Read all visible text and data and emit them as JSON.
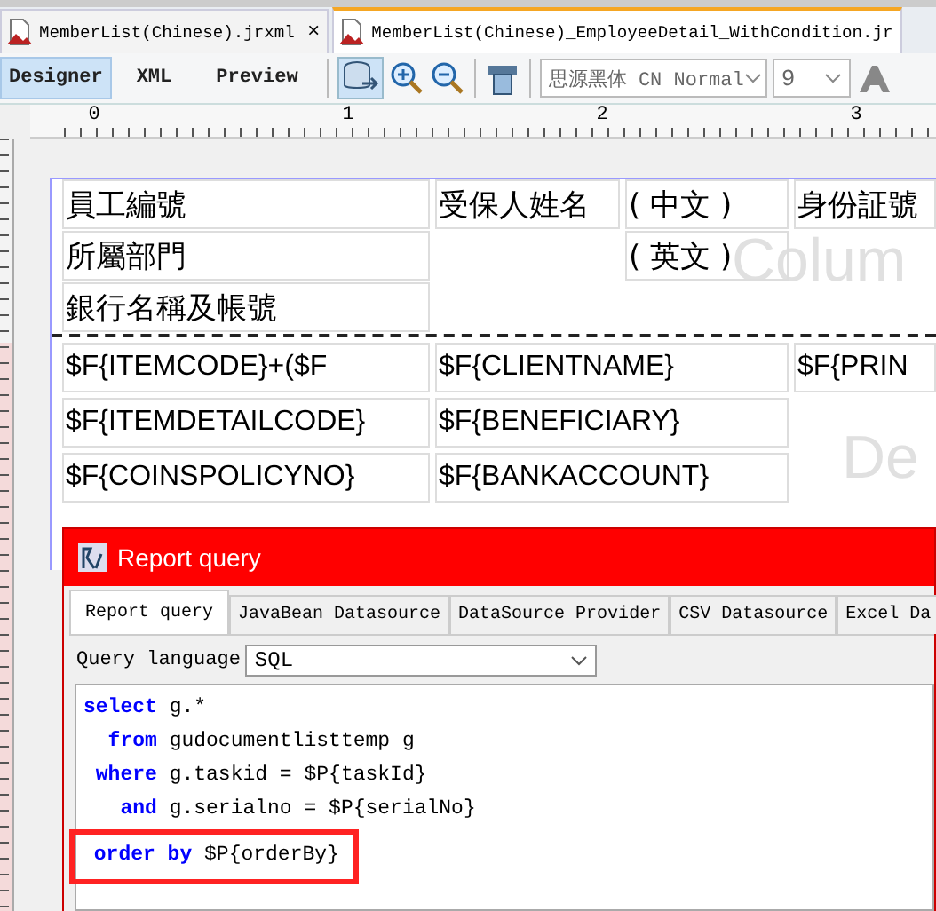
{
  "file_tabs": [
    {
      "label": "MemberList(Chinese).jrxml",
      "close": "×",
      "selected": false
    },
    {
      "label": "MemberList(Chinese)_EmployeeDetail_WithCondition.jr",
      "selected": true
    }
  ],
  "view_tabs": [
    {
      "label": "Designer",
      "selected": true
    },
    {
      "label": "XML",
      "selected": false
    },
    {
      "label": "Preview",
      "selected": false
    }
  ],
  "font_family": "思源黑体 CN Normal",
  "font_size": "9",
  "ruler": [
    "0",
    "1",
    "2",
    "3"
  ],
  "header_band": {
    "label": "Colum",
    "rows": [
      [
        "員工編號",
        "受保人姓名",
        "( 中文 )",
        "身份証號"
      ],
      [
        "所屬部門",
        "",
        "( 英文 )"
      ],
      [
        "銀行名稱及帳號"
      ]
    ]
  },
  "detail_band": {
    "label": "De",
    "rows": [
      [
        "$F{ITEMCODE}+($F",
        "$F{CLIENTNAME}",
        "$F{PRIN"
      ],
      [
        "$F{ITEMDETAILCODE}",
        "$F{BENEFICIARY}"
      ],
      [
        "$F{COINSPOLICYNO}",
        "$F{BANKACCOUNT}"
      ]
    ]
  },
  "dialog": {
    "title": "Report query",
    "tabs": [
      {
        "label": "Report query",
        "selected": true
      },
      {
        "label": "JavaBean Datasource",
        "selected": false
      },
      {
        "label": "DataSource Provider",
        "selected": false
      },
      {
        "label": "CSV Datasource",
        "selected": false
      },
      {
        "label": "Excel Da",
        "selected": false
      }
    ],
    "query_language": {
      "label": "Query language",
      "value": "SQL"
    },
    "code": [
      {
        "highlighted": false,
        "parts": [
          {
            "kind": "keyword",
            "text": "select"
          },
          {
            "kind": "plain",
            "text": " g.*"
          }
        ]
      },
      {
        "highlighted": false,
        "parts": [
          {
            "kind": "keyword",
            "text": "  from"
          },
          {
            "kind": "plain",
            "text": " gudocumentlisttemp g"
          }
        ]
      },
      {
        "highlighted": false,
        "parts": [
          {
            "kind": "keyword",
            "text": " where"
          },
          {
            "kind": "plain",
            "text": " g.taskid = $P{taskId}"
          }
        ]
      },
      {
        "highlighted": false,
        "parts": [
          {
            "kind": "keyword",
            "text": "   and"
          },
          {
            "kind": "plain",
            "text": " g.serialno = $P{serialNo}"
          }
        ]
      },
      {
        "highlighted": true,
        "parts": [
          {
            "kind": "keyword",
            "text": " order by"
          },
          {
            "kind": "plain",
            "text": " $P{orderBy}"
          }
        ]
      }
    ]
  }
}
